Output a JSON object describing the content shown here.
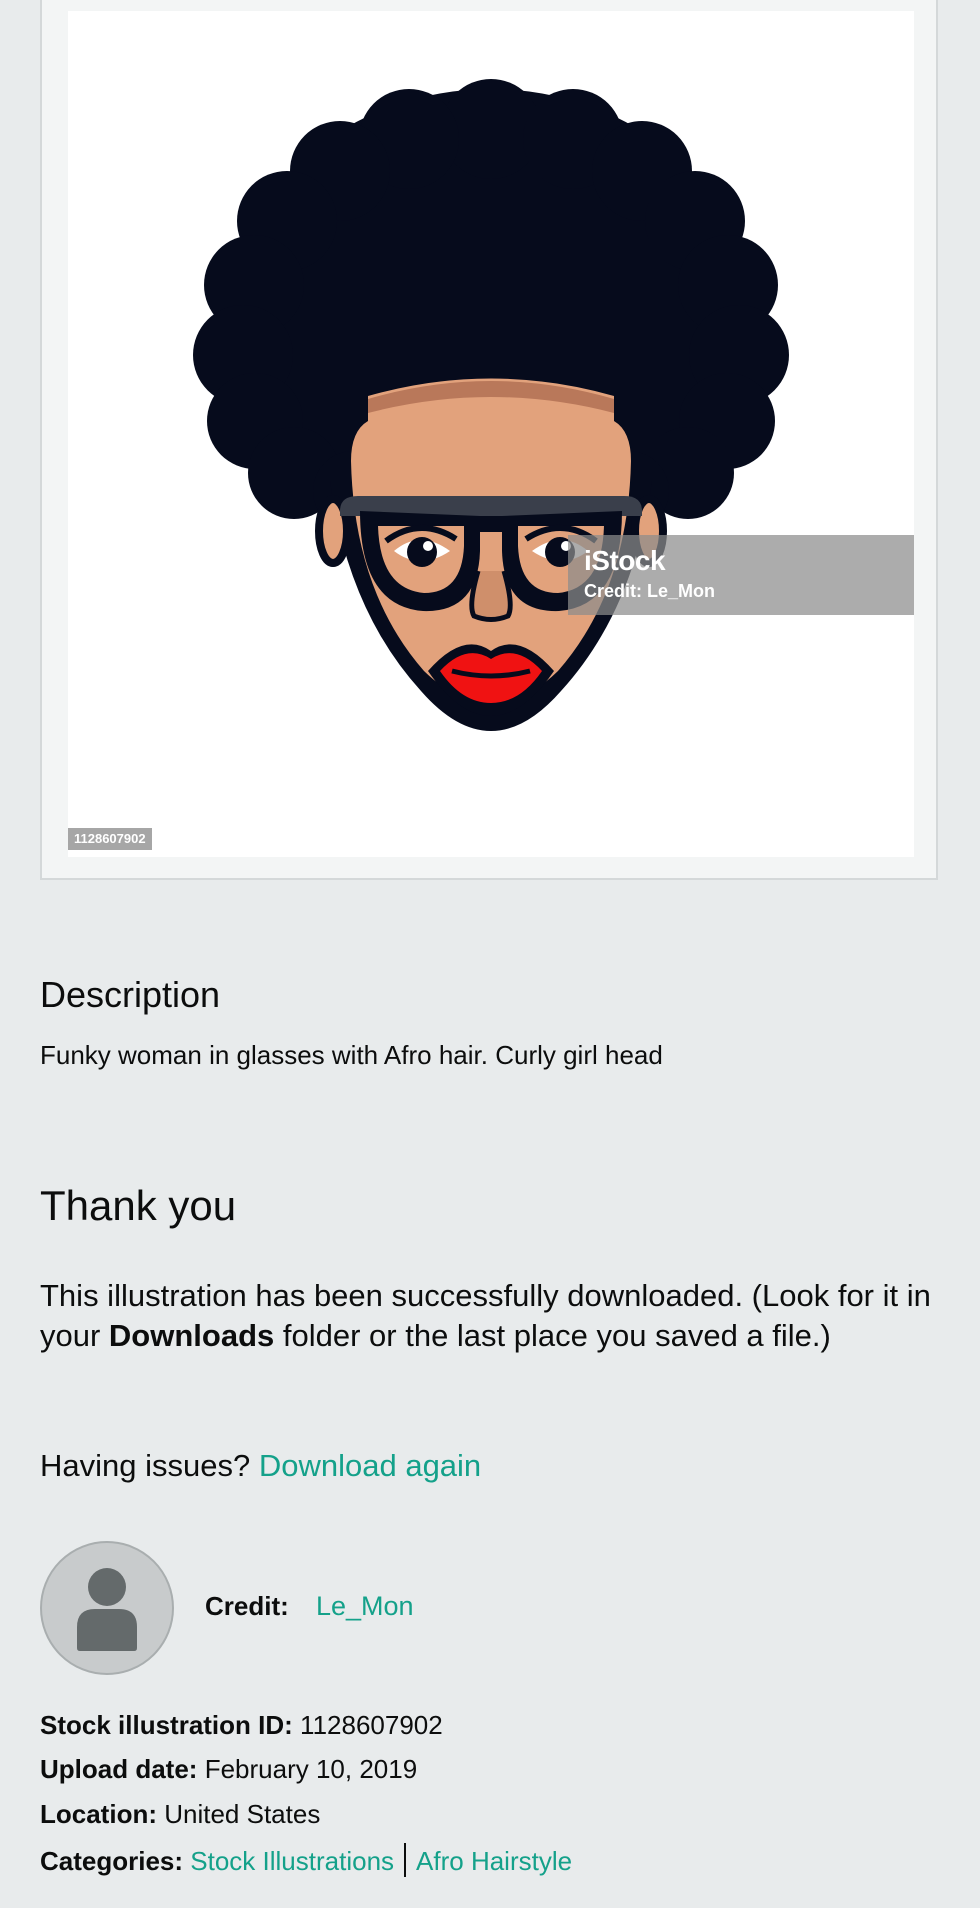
{
  "image": {
    "watermark_brand": "iStock",
    "watermark_credit": "Credit: Le_Mon",
    "id_badge": "1128607902",
    "alt": "Funky woman in glasses with Afro hair illustration"
  },
  "description": {
    "heading": "Description",
    "text": "Funky woman in glasses with Afro hair. Curly girl head"
  },
  "thanks": {
    "heading": "Thank you",
    "text_before": "This illustration has been successfully downloaded. (Look for it in your ",
    "text_bold": "Downloads",
    "text_after": " folder or the last place you saved a file.)",
    "issues_label": "Having issues?",
    "download_again_label": "Download again"
  },
  "credit": {
    "label": "Credit:",
    "name": "Le_Mon"
  },
  "meta": {
    "id_label": "Stock illustration ID:",
    "id_value": "1128607902",
    "date_label": "Upload date:",
    "date_value": "February 10, 2019",
    "location_label": "Location:",
    "location_value": "United States",
    "categories_label": "Categories:",
    "categories": [
      "Stock Illustrations",
      "Afro Hairstyle"
    ]
  },
  "colors": {
    "link": "#14a18a",
    "background": "#e8ebec",
    "hair": "#060b1c",
    "skin": "#e2a27c",
    "lips": "#f01212"
  }
}
